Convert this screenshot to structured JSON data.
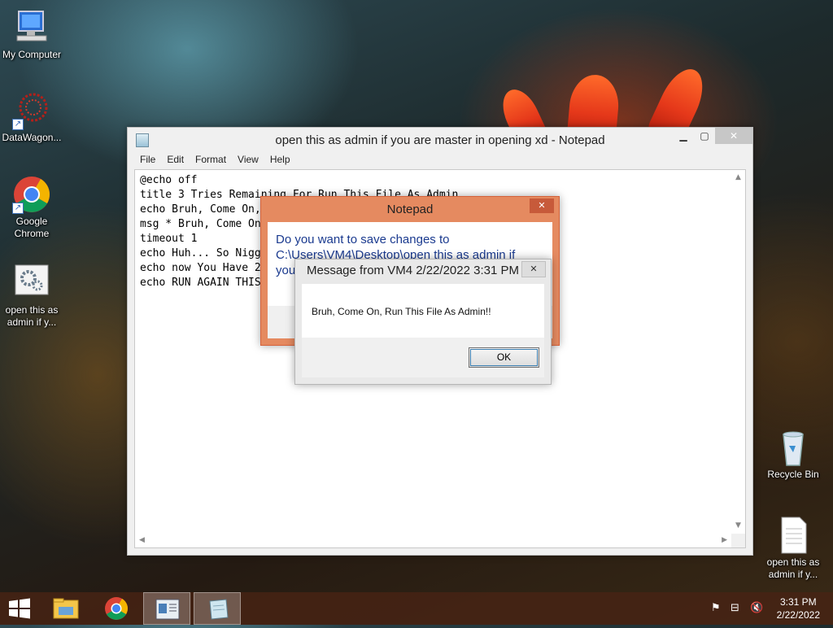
{
  "desktop": {
    "icons": [
      {
        "label": "My Computer",
        "icon": "computer-icon"
      },
      {
        "label": "DataWagon...",
        "icon": "datawagon-icon"
      },
      {
        "label": "Google Chrome",
        "icon": "chrome-icon"
      },
      {
        "label": "open this as admin if y...",
        "icon": "batch-file-icon"
      },
      {
        "label": "Recycle Bin",
        "icon": "recycle-bin-icon"
      },
      {
        "label": "open this as admin if y...",
        "icon": "text-file-icon"
      }
    ]
  },
  "notepad": {
    "title": "open this as admin if you are master in opening xd - Notepad",
    "menu": [
      "File",
      "Edit",
      "Format",
      "View",
      "Help"
    ],
    "text": "@echo off\ntitle 3 Tries Remaining For Run This File As Admin\necho Bruh, Come On,\nmsg * Bruh, Come On\ntimeout 1\necho Huh... So Nigg\necho now You Have 2\necho RUN AGAIN THIS",
    "close_glyph": "✕",
    "minimize_glyph": "▁",
    "maximize_glyph": "▢"
  },
  "save_dialog": {
    "title": "Notepad",
    "question_line1": "Do you want to save changes to",
    "question_line2": "C:\\Users\\VM4\\Desktop\\open this as admin if",
    "question_line3": "you",
    "close_glyph": "✕"
  },
  "message_box": {
    "title": "Message from VM4 2/22/2022 3:31 PM",
    "message": "Bruh, Come On, Run This File As Admin!!",
    "ok_label": "OK",
    "close_glyph": "✕"
  },
  "taskbar": {
    "items": [
      "start-button",
      "file-explorer",
      "google-chrome",
      "control-panel",
      "notepad"
    ],
    "active": "notepad",
    "clock_time": "3:31 PM",
    "clock_date": "2/22/2022"
  }
}
